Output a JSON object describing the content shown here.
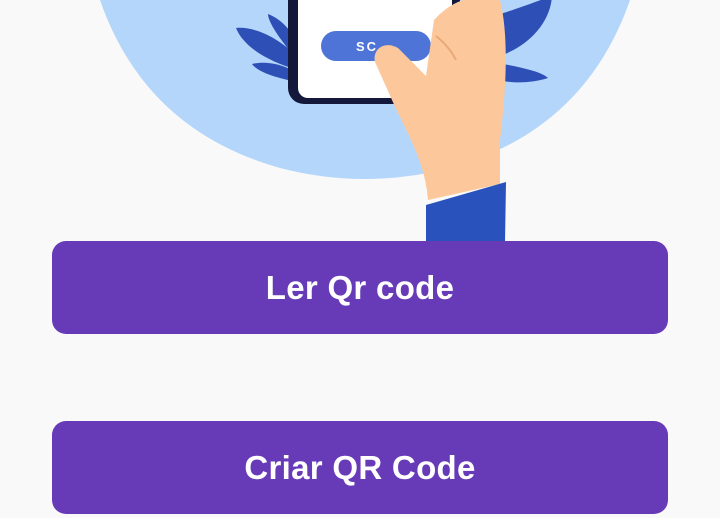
{
  "illustration": {
    "icon": "phone-qr-scan-illustration",
    "phone_button_label": "SC",
    "colors": {
      "circle": "#b4d6fb",
      "leaves": "#2e4fb6",
      "phone_frame": "#14183a",
      "phone_screen": "#ffffff",
      "phone_button": "#4f74d8",
      "skin": "#fcc89b",
      "sleeve": "#2a52bd"
    }
  },
  "actions": {
    "read_qr_label": "Ler Qr code",
    "create_qr_label": "Criar QR Code",
    "button_color": "#673ab7",
    "text_color": "#ffffff"
  }
}
